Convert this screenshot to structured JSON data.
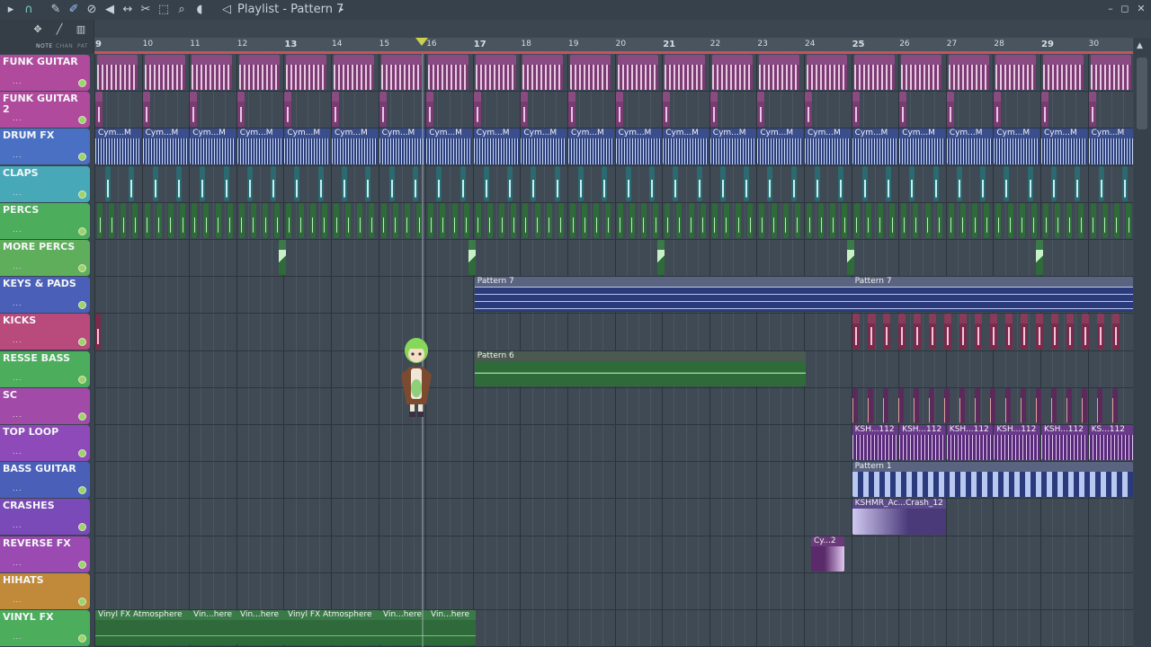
{
  "window": {
    "title": "Playlist - Pattern 7",
    "icons": [
      "play-icon",
      "magnet-icon",
      "pencil-icon",
      "paint-icon",
      "delete-icon",
      "mute-icon",
      "slip-icon",
      "slice-icon",
      "select-icon",
      "zoom-icon",
      "playback-icon",
      "speaker-icon"
    ]
  },
  "toolbar": {
    "note_label": "NOTE",
    "chan_label": "CHAN",
    "pat_label": "PAT"
  },
  "ruler": {
    "bars": [
      "9",
      "10",
      "11",
      "12",
      "13",
      "14",
      "15",
      "16",
      "17",
      "18",
      "19",
      "20",
      "21",
      "22",
      "23",
      "24",
      "25",
      "26",
      "27",
      "28",
      "29",
      "30"
    ]
  },
  "tracks": [
    {
      "name": "FUNK GUITAR",
      "color": "#b04a9c"
    },
    {
      "name": "FUNK GUITAR 2",
      "color": "#b04a9c"
    },
    {
      "name": "DRUM FX",
      "color": "#4a70c4"
    },
    {
      "name": "CLAPS",
      "color": "#47a9b8"
    },
    {
      "name": "PERCS",
      "color": "#4cad5c"
    },
    {
      "name": "MORE PERCS",
      "color": "#5fae5c"
    },
    {
      "name": "KEYS & PADS",
      "color": "#4a60b8"
    },
    {
      "name": "KICKS",
      "color": "#b84a7c"
    },
    {
      "name": "RESSE BASS",
      "color": "#4cad5c"
    },
    {
      "name": "SC",
      "color": "#a24aa8"
    },
    {
      "name": "TOP LOOP",
      "color": "#8e4ab8"
    },
    {
      "name": "BASS GUITAR",
      "color": "#4a60b8"
    },
    {
      "name": "CRASHES",
      "color": "#7a4ab8"
    },
    {
      "name": "REVERSE FX",
      "color": "#9a4ab0"
    },
    {
      "name": "HIHATS",
      "color": "#c08a3a"
    },
    {
      "name": "VINYL FX",
      "color": "#4cad5c"
    }
  ],
  "track_dots": "...",
  "clips": {
    "drum_fx_label": "Cym...M",
    "keys_pattern_1": "Pattern 7",
    "keys_pattern_2": "Pattern 7",
    "resse_pattern": "Pattern 6",
    "top_loop_label": "KSH...112",
    "top_loop_last": "KS...112",
    "bass_pattern": "Pattern 1",
    "crash_label": "KSHMR_Ac...Crash_12",
    "reverse_label": "Cy...2",
    "vinyl_1": "Vinyl FX Atmosphere",
    "vinyl_2": "Vin...here",
    "vinyl_3": "Vin...here",
    "vinyl_4": "Vinyl FX Atmosphere",
    "vinyl_5": "Vin...here",
    "vinyl_6": "Vin...here"
  }
}
